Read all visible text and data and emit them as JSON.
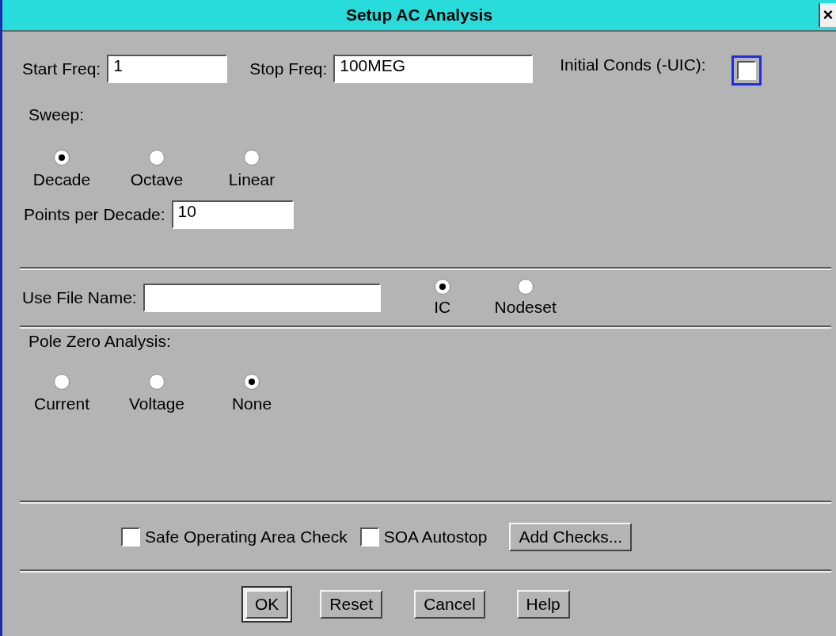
{
  "window": {
    "title": "Setup AC Analysis",
    "close": "×"
  },
  "frequency": {
    "start": {
      "label": "Start Freq:",
      "value": "1"
    },
    "stop": {
      "label": "Stop Freq:",
      "value": "100MEG"
    },
    "initial_conds": {
      "label": "Initial Conds (-UIC):",
      "checked": false,
      "focused": true
    }
  },
  "sweep": {
    "label": "Sweep:",
    "options": [
      {
        "label": "Decade",
        "selected": true
      },
      {
        "label": "Octave",
        "selected": false
      },
      {
        "label": "Linear",
        "selected": false
      }
    ]
  },
  "points": {
    "label": "Points per Decade:",
    "value": "10"
  },
  "file": {
    "label": "Use File Name:",
    "options": [
      {
        "label": "IC",
        "selected": true
      },
      {
        "label": "Nodeset",
        "selected": false
      }
    ]
  },
  "pole_zero": {
    "label": "Pole Zero Analysis:",
    "options": [
      {
        "label": "Current",
        "selected": false
      },
      {
        "label": "Voltage",
        "selected": false
      },
      {
        "label": "None",
        "selected": true
      }
    ]
  },
  "checks": [
    {
      "label": "Safe Operating Area Check",
      "checked": false
    },
    {
      "label": "SOA Autostop",
      "checked": false
    }
  ],
  "add_checks": "Add Checks...",
  "buttons": [
    {
      "label": "OK",
      "default": true
    },
    {
      "label": "Reset",
      "default": false
    },
    {
      "label": "Cancel",
      "default": false
    },
    {
      "label": "Help",
      "default": false
    }
  ]
}
